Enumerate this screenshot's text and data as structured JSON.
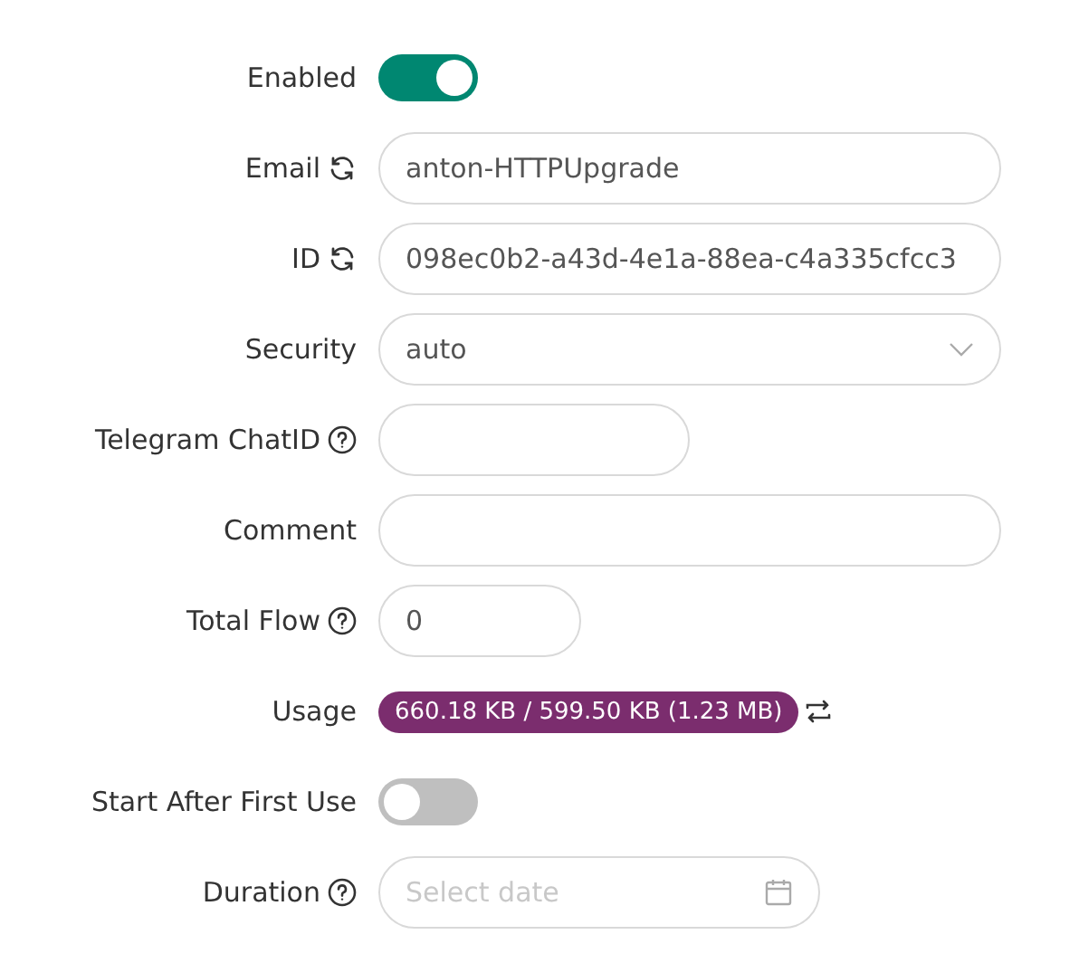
{
  "form": [
    {
      "label": "Enabled",
      "kind": "switch",
      "on": true,
      "refresh": false,
      "help": false
    },
    {
      "label": "Email",
      "refresh": true,
      "help": false,
      "kind": "wide-input",
      "value": "anton-HTTPUpgrade"
    },
    {
      "label": "ID",
      "refresh": true,
      "help": false,
      "kind": "wide-input",
      "value": "098ec0b2-a43d-4e1a-88ea-c4a335cfcc3"
    },
    {
      "label": "Security",
      "refresh": false,
      "help": false,
      "kind": "select",
      "value": "auto"
    },
    {
      "label": "Telegram ChatID",
      "refresh": false,
      "help": true,
      "kind": "medium-input"
    },
    {
      "label": "Comment",
      "refresh": false,
      "help": false,
      "kind": "wide-input"
    },
    {
      "label": "Total Flow",
      "refresh": false,
      "help": true,
      "kind": "short-input",
      "value": "0"
    },
    {
      "label": "Usage",
      "refresh": false,
      "help": false,
      "kind": "badge",
      "value": "660.18 KB / 599.50 KB (1.23 MB)",
      "color": "#7b2d6e",
      "swap": true
    },
    {
      "label": "Start After First Use",
      "refresh": false,
      "help": false,
      "kind": "switch",
      "on": false
    },
    {
      "label": "Duration",
      "refresh": false,
      "help": true,
      "kind": "date",
      "placeholder": "Select date"
    }
  ]
}
